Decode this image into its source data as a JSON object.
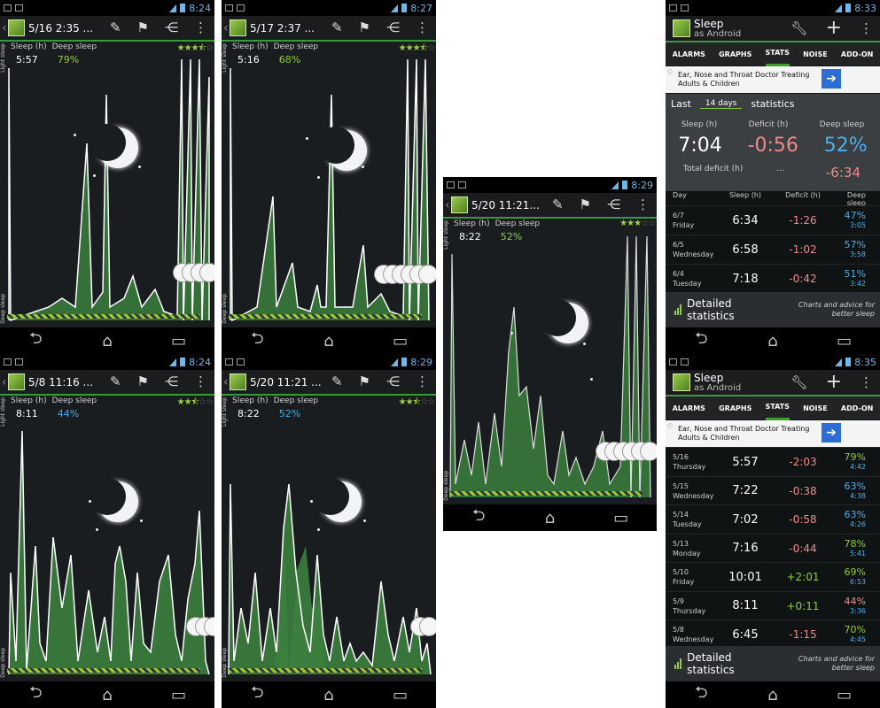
{
  "panels": [
    {
      "title": "5/16 2:35 ...",
      "time": "8:24",
      "sleep_label": "Sleep (h)",
      "deep_label": "Deep sleep",
      "sleep": "5:57",
      "deep": "79%",
      "stars": 3.5
    },
    {
      "title": "5/17 2:37 ...",
      "time": "8:27",
      "sleep_label": "Sleep (h)",
      "deep_label": "Deep sleep",
      "sleep": "5:16",
      "deep": "68%",
      "stars": 3.5
    },
    {
      "title": "5/8 11:16 ...",
      "time": "8:24",
      "sleep_label": "Sleep (h)",
      "deep_label": "Deep sleep",
      "sleep": "8:11",
      "deep": "44%",
      "stars": 2.5
    },
    {
      "title": "5/20 11:21 ...",
      "time": "8:29",
      "sleep_label": "Sleep (h)",
      "deep_label": "Deep sleep",
      "sleep": "8:22",
      "deep": "52%",
      "stars": 2.5
    },
    {
      "title": "5/20 11:21...",
      "time": "8:29",
      "sleep_label": "Sleep (h)",
      "deep_label": "Deep sleep",
      "sleep": "8:22",
      "deep": "52%",
      "stars": 3
    }
  ],
  "axis": {
    "light": "Light sleep",
    "deep": "Deep sleep"
  },
  "stats_top": {
    "time": "8:33",
    "app_title": "Sleep",
    "app_sub": "as Android",
    "tabs": [
      "ALARMS",
      "GRAPHS",
      "STATS",
      "NOISE",
      "ADD-ON"
    ],
    "ad_text": "Ear, Nose and Throat Doctor Treating Adults & Children",
    "last": "Last",
    "days": "14 days",
    "statistics": "statistics",
    "labels": {
      "sleep": "Sleep (h)",
      "deficit": "Deficit (h)",
      "deep": "Deep sleep"
    },
    "sleep": "7:04",
    "deficit": "-0:56",
    "deep": "52%",
    "total_label": "Total deficit (h)",
    "total_dots": "...",
    "total": "-6:34",
    "cols": {
      "day": "Day",
      "sleep": "Sleep (h)",
      "deficit": "Deficit (h)",
      "deep": "Deep sleep"
    },
    "rows": [
      {
        "date": "6/7",
        "weekday": "Friday",
        "sleep": "6:34",
        "deficit": "-1:26",
        "pct": "47%",
        "dur": "3:05"
      },
      {
        "date": "6/5",
        "weekday": "Wednesday",
        "sleep": "6:58",
        "deficit": "-1:02",
        "pct": "57%",
        "dur": "3:58"
      },
      {
        "date": "6/4",
        "weekday": "Tuesday",
        "sleep": "7:18",
        "deficit": "-0:42",
        "pct": "51%",
        "dur": "3:42"
      }
    ],
    "detailed": "Detailed statistics",
    "advice": "Charts and advice for better sleep"
  },
  "stats_bottom": {
    "time": "8:35",
    "app_title": "Sleep",
    "app_sub": "as Android",
    "tabs": [
      "ALARMS",
      "GRAPHS",
      "STATS",
      "NOISE",
      "ADD-ON"
    ],
    "ad_text": "Ear, Nose and Throat Doctor Treating Adults & Children",
    "rows": [
      {
        "date": "5/16",
        "weekday": "Thursday",
        "sleep": "5:57",
        "deficit": "-2:03",
        "pct": "79%",
        "dur": "4:42",
        "pct_color": "green"
      },
      {
        "date": "5/15",
        "weekday": "Wednesday",
        "sleep": "7:22",
        "deficit": "-0:38",
        "pct": "63%",
        "dur": "4:38",
        "pct_color": "blue"
      },
      {
        "date": "5/14",
        "weekday": "Tuesday",
        "sleep": "7:02",
        "deficit": "-0:58",
        "pct": "63%",
        "dur": "4:26",
        "pct_color": "blue"
      },
      {
        "date": "5/13",
        "weekday": "Monday",
        "sleep": "7:16",
        "deficit": "-0:44",
        "pct": "78%",
        "dur": "5:41",
        "pct_color": "green"
      },
      {
        "date": "5/10",
        "weekday": "Friday",
        "sleep": "10:01",
        "deficit": "+2:01",
        "pct": "69%",
        "dur": "6:53",
        "pct_color": "green"
      },
      {
        "date": "5/9",
        "weekday": "Thursday",
        "sleep": "8:11",
        "deficit": "+0:11",
        "pct": "44%",
        "dur": "3:36",
        "pct_color": "red"
      },
      {
        "date": "5/8",
        "weekday": "Wednesday",
        "sleep": "6:45",
        "deficit": "-1:15",
        "pct": "70%",
        "dur": "4:45",
        "pct_color": "green"
      }
    ],
    "detailed": "Detailed statistics",
    "advice": "Charts and advice for better sleep"
  },
  "colors": {
    "accent": "#3a9a3a",
    "deep_green": "#8fce3a",
    "blue": "#46a8e0",
    "red": "#ef8a8a"
  }
}
